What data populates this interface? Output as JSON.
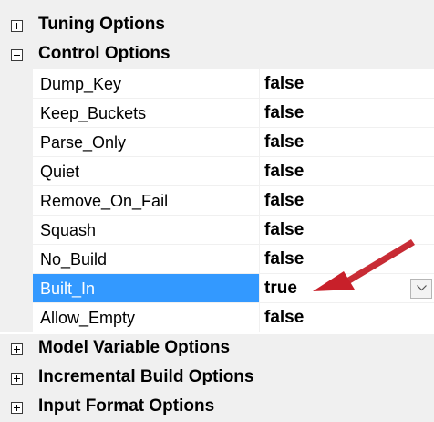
{
  "categories": {
    "tuning": {
      "label": "Tuning Options",
      "icon": "plus-square-icon"
    },
    "control": {
      "label": "Control Options",
      "icon": "minus-square-icon"
    },
    "model_variable": {
      "label": "Model Variable Options",
      "icon": "plus-square-icon"
    },
    "incremental_build": {
      "label": "Incremental Build Options",
      "icon": "plus-square-icon"
    },
    "input_format": {
      "label": "Input Format Options",
      "icon": "plus-square-icon"
    }
  },
  "properties": [
    {
      "name": "Dump_Key",
      "value": "false"
    },
    {
      "name": "Keep_Buckets",
      "value": "false"
    },
    {
      "name": "Parse_Only",
      "value": "false"
    },
    {
      "name": "Quiet",
      "value": "false"
    },
    {
      "name": "Remove_On_Fail",
      "value": "false"
    },
    {
      "name": "Squash",
      "value": "false"
    },
    {
      "name": "No_Build",
      "value": "false"
    },
    {
      "name": "Built_In",
      "value": "true",
      "selected": true,
      "dropdown_icon": "chevron-down-icon"
    },
    {
      "name": "Allow_Empty",
      "value": "false"
    }
  ],
  "colors": {
    "selection": "#3399ff",
    "gutter": "#f0f0f0",
    "annotation_arrow": "#c8202a"
  }
}
